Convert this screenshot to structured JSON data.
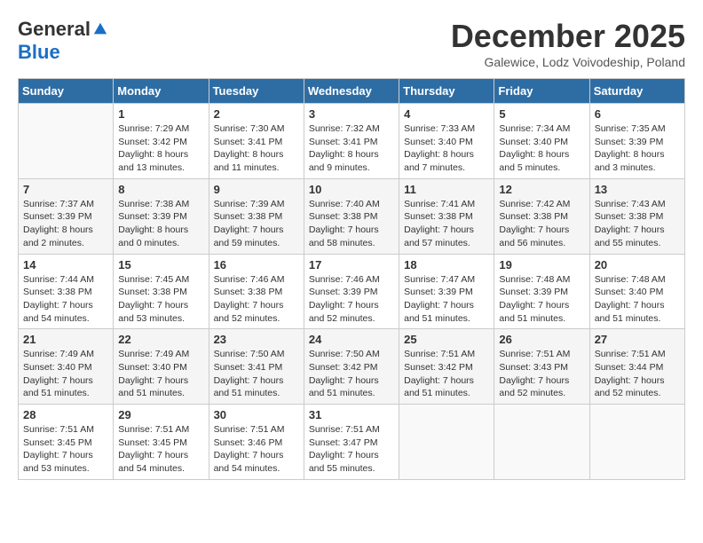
{
  "logo": {
    "general": "General",
    "blue": "Blue"
  },
  "title": "December 2025",
  "location": "Galewice, Lodz Voivodeship, Poland",
  "days_header": [
    "Sunday",
    "Monday",
    "Tuesday",
    "Wednesday",
    "Thursday",
    "Friday",
    "Saturday"
  ],
  "weeks": [
    [
      {
        "day": "",
        "info": ""
      },
      {
        "day": "1",
        "info": "Sunrise: 7:29 AM\nSunset: 3:42 PM\nDaylight: 8 hours\nand 13 minutes."
      },
      {
        "day": "2",
        "info": "Sunrise: 7:30 AM\nSunset: 3:41 PM\nDaylight: 8 hours\nand 11 minutes."
      },
      {
        "day": "3",
        "info": "Sunrise: 7:32 AM\nSunset: 3:41 PM\nDaylight: 8 hours\nand 9 minutes."
      },
      {
        "day": "4",
        "info": "Sunrise: 7:33 AM\nSunset: 3:40 PM\nDaylight: 8 hours\nand 7 minutes."
      },
      {
        "day": "5",
        "info": "Sunrise: 7:34 AM\nSunset: 3:40 PM\nDaylight: 8 hours\nand 5 minutes."
      },
      {
        "day": "6",
        "info": "Sunrise: 7:35 AM\nSunset: 3:39 PM\nDaylight: 8 hours\nand 3 minutes."
      }
    ],
    [
      {
        "day": "7",
        "info": "Sunrise: 7:37 AM\nSunset: 3:39 PM\nDaylight: 8 hours\nand 2 minutes."
      },
      {
        "day": "8",
        "info": "Sunrise: 7:38 AM\nSunset: 3:39 PM\nDaylight: 8 hours\nand 0 minutes."
      },
      {
        "day": "9",
        "info": "Sunrise: 7:39 AM\nSunset: 3:38 PM\nDaylight: 7 hours\nand 59 minutes."
      },
      {
        "day": "10",
        "info": "Sunrise: 7:40 AM\nSunset: 3:38 PM\nDaylight: 7 hours\nand 58 minutes."
      },
      {
        "day": "11",
        "info": "Sunrise: 7:41 AM\nSunset: 3:38 PM\nDaylight: 7 hours\nand 57 minutes."
      },
      {
        "day": "12",
        "info": "Sunrise: 7:42 AM\nSunset: 3:38 PM\nDaylight: 7 hours\nand 56 minutes."
      },
      {
        "day": "13",
        "info": "Sunrise: 7:43 AM\nSunset: 3:38 PM\nDaylight: 7 hours\nand 55 minutes."
      }
    ],
    [
      {
        "day": "14",
        "info": "Sunrise: 7:44 AM\nSunset: 3:38 PM\nDaylight: 7 hours\nand 54 minutes."
      },
      {
        "day": "15",
        "info": "Sunrise: 7:45 AM\nSunset: 3:38 PM\nDaylight: 7 hours\nand 53 minutes."
      },
      {
        "day": "16",
        "info": "Sunrise: 7:46 AM\nSunset: 3:38 PM\nDaylight: 7 hours\nand 52 minutes."
      },
      {
        "day": "17",
        "info": "Sunrise: 7:46 AM\nSunset: 3:39 PM\nDaylight: 7 hours\nand 52 minutes."
      },
      {
        "day": "18",
        "info": "Sunrise: 7:47 AM\nSunset: 3:39 PM\nDaylight: 7 hours\nand 51 minutes."
      },
      {
        "day": "19",
        "info": "Sunrise: 7:48 AM\nSunset: 3:39 PM\nDaylight: 7 hours\nand 51 minutes."
      },
      {
        "day": "20",
        "info": "Sunrise: 7:48 AM\nSunset: 3:40 PM\nDaylight: 7 hours\nand 51 minutes."
      }
    ],
    [
      {
        "day": "21",
        "info": "Sunrise: 7:49 AM\nSunset: 3:40 PM\nDaylight: 7 hours\nand 51 minutes."
      },
      {
        "day": "22",
        "info": "Sunrise: 7:49 AM\nSunset: 3:40 PM\nDaylight: 7 hours\nand 51 minutes."
      },
      {
        "day": "23",
        "info": "Sunrise: 7:50 AM\nSunset: 3:41 PM\nDaylight: 7 hours\nand 51 minutes."
      },
      {
        "day": "24",
        "info": "Sunrise: 7:50 AM\nSunset: 3:42 PM\nDaylight: 7 hours\nand 51 minutes."
      },
      {
        "day": "25",
        "info": "Sunrise: 7:51 AM\nSunset: 3:42 PM\nDaylight: 7 hours\nand 51 minutes."
      },
      {
        "day": "26",
        "info": "Sunrise: 7:51 AM\nSunset: 3:43 PM\nDaylight: 7 hours\nand 52 minutes."
      },
      {
        "day": "27",
        "info": "Sunrise: 7:51 AM\nSunset: 3:44 PM\nDaylight: 7 hours\nand 52 minutes."
      }
    ],
    [
      {
        "day": "28",
        "info": "Sunrise: 7:51 AM\nSunset: 3:45 PM\nDaylight: 7 hours\nand 53 minutes."
      },
      {
        "day": "29",
        "info": "Sunrise: 7:51 AM\nSunset: 3:45 PM\nDaylight: 7 hours\nand 54 minutes."
      },
      {
        "day": "30",
        "info": "Sunrise: 7:51 AM\nSunset: 3:46 PM\nDaylight: 7 hours\nand 54 minutes."
      },
      {
        "day": "31",
        "info": "Sunrise: 7:51 AM\nSunset: 3:47 PM\nDaylight: 7 hours\nand 55 minutes."
      },
      {
        "day": "",
        "info": ""
      },
      {
        "day": "",
        "info": ""
      },
      {
        "day": "",
        "info": ""
      }
    ]
  ]
}
